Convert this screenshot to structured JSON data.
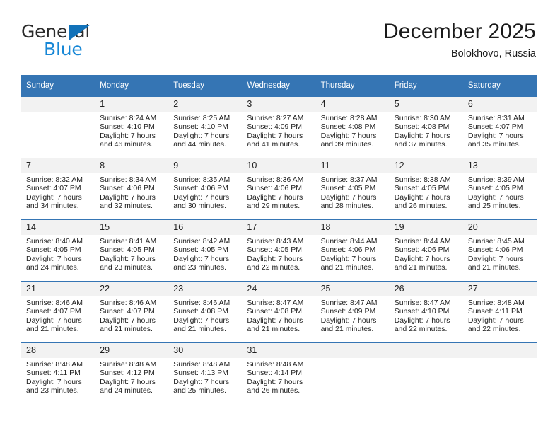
{
  "brand": {
    "name_top": "General",
    "name_bottom": "Blue",
    "triangle_color": "#1272b9",
    "blue_color": "#1787d6"
  },
  "header": {
    "title": "December 2025",
    "subtitle": "Bolokhovo, Russia"
  },
  "theme": {
    "header_bg": "#3575b4",
    "header_text": "#ffffff",
    "daynum_bg": "#f2f2f2",
    "cell_bg": "#ffffff",
    "row_border": "#3575b4"
  },
  "weekday_headers": [
    "Sunday",
    "Monday",
    "Tuesday",
    "Wednesday",
    "Thursday",
    "Friday",
    "Saturday"
  ],
  "weeks": [
    [
      {
        "day": "",
        "sunrise": "",
        "sunset": "",
        "daylight_line1": "",
        "daylight_line2": "",
        "empty": true
      },
      {
        "day": "1",
        "sunrise": "Sunrise: 8:24 AM",
        "sunset": "Sunset: 4:10 PM",
        "daylight_line1": "Daylight: 7 hours",
        "daylight_line2": "and 46 minutes.",
        "empty": false
      },
      {
        "day": "2",
        "sunrise": "Sunrise: 8:25 AM",
        "sunset": "Sunset: 4:10 PM",
        "daylight_line1": "Daylight: 7 hours",
        "daylight_line2": "and 44 minutes.",
        "empty": false
      },
      {
        "day": "3",
        "sunrise": "Sunrise: 8:27 AM",
        "sunset": "Sunset: 4:09 PM",
        "daylight_line1": "Daylight: 7 hours",
        "daylight_line2": "and 41 minutes.",
        "empty": false
      },
      {
        "day": "4",
        "sunrise": "Sunrise: 8:28 AM",
        "sunset": "Sunset: 4:08 PM",
        "daylight_line1": "Daylight: 7 hours",
        "daylight_line2": "and 39 minutes.",
        "empty": false
      },
      {
        "day": "5",
        "sunrise": "Sunrise: 8:30 AM",
        "sunset": "Sunset: 4:08 PM",
        "daylight_line1": "Daylight: 7 hours",
        "daylight_line2": "and 37 minutes.",
        "empty": false
      },
      {
        "day": "6",
        "sunrise": "Sunrise: 8:31 AM",
        "sunset": "Sunset: 4:07 PM",
        "daylight_line1": "Daylight: 7 hours",
        "daylight_line2": "and 35 minutes.",
        "empty": false
      }
    ],
    [
      {
        "day": "7",
        "sunrise": "Sunrise: 8:32 AM",
        "sunset": "Sunset: 4:07 PM",
        "daylight_line1": "Daylight: 7 hours",
        "daylight_line2": "and 34 minutes.",
        "empty": false
      },
      {
        "day": "8",
        "sunrise": "Sunrise: 8:34 AM",
        "sunset": "Sunset: 4:06 PM",
        "daylight_line1": "Daylight: 7 hours",
        "daylight_line2": "and 32 minutes.",
        "empty": false
      },
      {
        "day": "9",
        "sunrise": "Sunrise: 8:35 AM",
        "sunset": "Sunset: 4:06 PM",
        "daylight_line1": "Daylight: 7 hours",
        "daylight_line2": "and 30 minutes.",
        "empty": false
      },
      {
        "day": "10",
        "sunrise": "Sunrise: 8:36 AM",
        "sunset": "Sunset: 4:06 PM",
        "daylight_line1": "Daylight: 7 hours",
        "daylight_line2": "and 29 minutes.",
        "empty": false
      },
      {
        "day": "11",
        "sunrise": "Sunrise: 8:37 AM",
        "sunset": "Sunset: 4:05 PM",
        "daylight_line1": "Daylight: 7 hours",
        "daylight_line2": "and 28 minutes.",
        "empty": false
      },
      {
        "day": "12",
        "sunrise": "Sunrise: 8:38 AM",
        "sunset": "Sunset: 4:05 PM",
        "daylight_line1": "Daylight: 7 hours",
        "daylight_line2": "and 26 minutes.",
        "empty": false
      },
      {
        "day": "13",
        "sunrise": "Sunrise: 8:39 AM",
        "sunset": "Sunset: 4:05 PM",
        "daylight_line1": "Daylight: 7 hours",
        "daylight_line2": "and 25 minutes.",
        "empty": false
      }
    ],
    [
      {
        "day": "14",
        "sunrise": "Sunrise: 8:40 AM",
        "sunset": "Sunset: 4:05 PM",
        "daylight_line1": "Daylight: 7 hours",
        "daylight_line2": "and 24 minutes.",
        "empty": false
      },
      {
        "day": "15",
        "sunrise": "Sunrise: 8:41 AM",
        "sunset": "Sunset: 4:05 PM",
        "daylight_line1": "Daylight: 7 hours",
        "daylight_line2": "and 23 minutes.",
        "empty": false
      },
      {
        "day": "16",
        "sunrise": "Sunrise: 8:42 AM",
        "sunset": "Sunset: 4:05 PM",
        "daylight_line1": "Daylight: 7 hours",
        "daylight_line2": "and 23 minutes.",
        "empty": false
      },
      {
        "day": "17",
        "sunrise": "Sunrise: 8:43 AM",
        "sunset": "Sunset: 4:05 PM",
        "daylight_line1": "Daylight: 7 hours",
        "daylight_line2": "and 22 minutes.",
        "empty": false
      },
      {
        "day": "18",
        "sunrise": "Sunrise: 8:44 AM",
        "sunset": "Sunset: 4:06 PM",
        "daylight_line1": "Daylight: 7 hours",
        "daylight_line2": "and 21 minutes.",
        "empty": false
      },
      {
        "day": "19",
        "sunrise": "Sunrise: 8:44 AM",
        "sunset": "Sunset: 4:06 PM",
        "daylight_line1": "Daylight: 7 hours",
        "daylight_line2": "and 21 minutes.",
        "empty": false
      },
      {
        "day": "20",
        "sunrise": "Sunrise: 8:45 AM",
        "sunset": "Sunset: 4:06 PM",
        "daylight_line1": "Daylight: 7 hours",
        "daylight_line2": "and 21 minutes.",
        "empty": false
      }
    ],
    [
      {
        "day": "21",
        "sunrise": "Sunrise: 8:46 AM",
        "sunset": "Sunset: 4:07 PM",
        "daylight_line1": "Daylight: 7 hours",
        "daylight_line2": "and 21 minutes.",
        "empty": false
      },
      {
        "day": "22",
        "sunrise": "Sunrise: 8:46 AM",
        "sunset": "Sunset: 4:07 PM",
        "daylight_line1": "Daylight: 7 hours",
        "daylight_line2": "and 21 minutes.",
        "empty": false
      },
      {
        "day": "23",
        "sunrise": "Sunrise: 8:46 AM",
        "sunset": "Sunset: 4:08 PM",
        "daylight_line1": "Daylight: 7 hours",
        "daylight_line2": "and 21 minutes.",
        "empty": false
      },
      {
        "day": "24",
        "sunrise": "Sunrise: 8:47 AM",
        "sunset": "Sunset: 4:08 PM",
        "daylight_line1": "Daylight: 7 hours",
        "daylight_line2": "and 21 minutes.",
        "empty": false
      },
      {
        "day": "25",
        "sunrise": "Sunrise: 8:47 AM",
        "sunset": "Sunset: 4:09 PM",
        "daylight_line1": "Daylight: 7 hours",
        "daylight_line2": "and 21 minutes.",
        "empty": false
      },
      {
        "day": "26",
        "sunrise": "Sunrise: 8:47 AM",
        "sunset": "Sunset: 4:10 PM",
        "daylight_line1": "Daylight: 7 hours",
        "daylight_line2": "and 22 minutes.",
        "empty": false
      },
      {
        "day": "27",
        "sunrise": "Sunrise: 8:48 AM",
        "sunset": "Sunset: 4:11 PM",
        "daylight_line1": "Daylight: 7 hours",
        "daylight_line2": "and 22 minutes.",
        "empty": false
      }
    ],
    [
      {
        "day": "28",
        "sunrise": "Sunrise: 8:48 AM",
        "sunset": "Sunset: 4:11 PM",
        "daylight_line1": "Daylight: 7 hours",
        "daylight_line2": "and 23 minutes.",
        "empty": false
      },
      {
        "day": "29",
        "sunrise": "Sunrise: 8:48 AM",
        "sunset": "Sunset: 4:12 PM",
        "daylight_line1": "Daylight: 7 hours",
        "daylight_line2": "and 24 minutes.",
        "empty": false
      },
      {
        "day": "30",
        "sunrise": "Sunrise: 8:48 AM",
        "sunset": "Sunset: 4:13 PM",
        "daylight_line1": "Daylight: 7 hours",
        "daylight_line2": "and 25 minutes.",
        "empty": false
      },
      {
        "day": "31",
        "sunrise": "Sunrise: 8:48 AM",
        "sunset": "Sunset: 4:14 PM",
        "daylight_line1": "Daylight: 7 hours",
        "daylight_line2": "and 26 minutes.",
        "empty": false
      },
      {
        "day": "",
        "sunrise": "",
        "sunset": "",
        "daylight_line1": "",
        "daylight_line2": "",
        "empty": true
      },
      {
        "day": "",
        "sunrise": "",
        "sunset": "",
        "daylight_line1": "",
        "daylight_line2": "",
        "empty": true
      },
      {
        "day": "",
        "sunrise": "",
        "sunset": "",
        "daylight_line1": "",
        "daylight_line2": "",
        "empty": true
      }
    ]
  ]
}
